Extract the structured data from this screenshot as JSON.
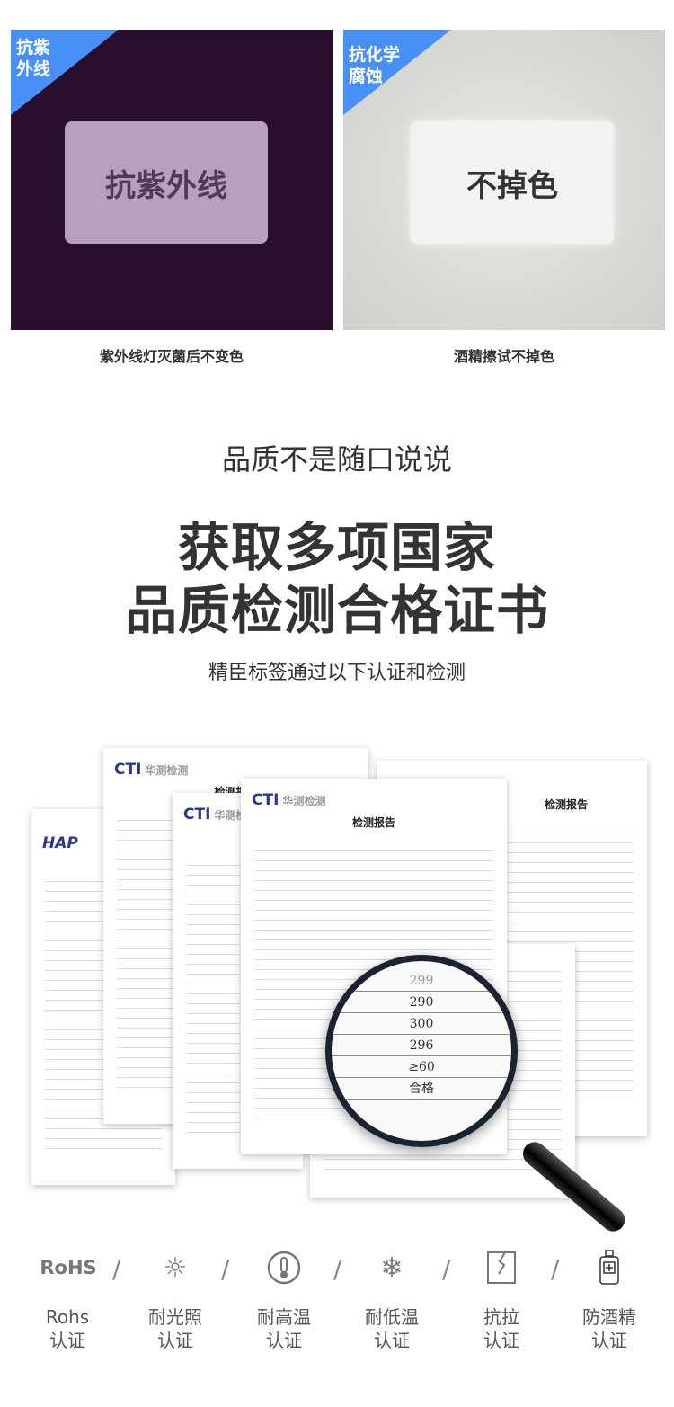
{
  "panels": [
    {
      "badge_line1": "抗紫",
      "badge_line2": "外线",
      "label_text": "抗紫外线",
      "caption": "紫外线灯灭菌后不变色",
      "badge_color": "#4890f8"
    },
    {
      "badge_line1": "抗化学",
      "badge_line2": "腐蚀",
      "label_text": "不掉色",
      "caption": "酒精擦试不掉色",
      "badge_color": "#4890f8"
    }
  ],
  "headline": {
    "intro": "品质不是随口说说",
    "title_line1": "获取多项国家",
    "title_line2": "品质检测合格证书",
    "subtitle": "精臣标签通过以下认证和检测"
  },
  "documents": {
    "cti_logo": "CTI",
    "cti_name": "华测检测",
    "hap_logo": "HAP",
    "report_title": "检测报告"
  },
  "magnifier_values": [
    "299",
    "290",
    "300",
    "296",
    "≥60",
    "合格"
  ],
  "certifications": [
    {
      "icon": "rohs-text-icon",
      "icon_text": "RoHS",
      "line1": "Rohs",
      "line2": "认证"
    },
    {
      "icon": "sun-icon",
      "line1": "耐光照",
      "line2": "认证"
    },
    {
      "icon": "thermometer-icon",
      "line1": "耐高温",
      "line2": "认证"
    },
    {
      "icon": "snowflake-icon",
      "line1": "耐低温",
      "line2": "认证"
    },
    {
      "icon": "torn-paper-icon",
      "line1": "抗拉",
      "line2": "认证"
    },
    {
      "icon": "alcohol-bottle-icon",
      "line1": "防酒精",
      "line2": "认证"
    }
  ]
}
